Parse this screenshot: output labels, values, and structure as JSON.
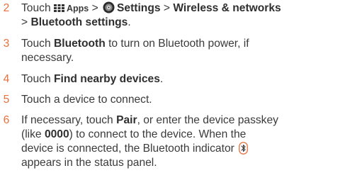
{
  "steps": [
    {
      "number": "2",
      "prefix": "Touch",
      "apps_label": "Apps",
      "sep1": ">",
      "settings_label": "Settings",
      "sep2": ">",
      "wireless_label": "Wireless & networks",
      "sep3": ">",
      "bt_settings_label": "Bluetooth settings",
      "end": "."
    },
    {
      "number": "3",
      "prefix": "Touch",
      "bold": "Bluetooth",
      "line1_rest": "to turn on Bluetooth power, if",
      "line2": "necessary."
    },
    {
      "number": "4",
      "prefix": "Touch",
      "bold": "Find nearby devices",
      "end": "."
    },
    {
      "number": "5",
      "text": "Touch a device to connect."
    },
    {
      "number": "6",
      "l1_prefix": "If necessary, touch",
      "l1_bold": "Pair",
      "l1_rest": ", or enter the device passkey",
      "l2_prefix": "(like",
      "l2_bold": "0000",
      "l2_rest": ") to connect to the device. When the",
      "l3": "device is connected, the Bluetooth indicator",
      "l4": "appears in the status panel."
    }
  ],
  "icons": {
    "apps": "apps-grid-icon",
    "settings": "settings-gear-icon",
    "bluetooth": "bluetooth-indicator-icon"
  },
  "colors": {
    "step_number": "#e8703c",
    "text": "#3a3a3a"
  }
}
